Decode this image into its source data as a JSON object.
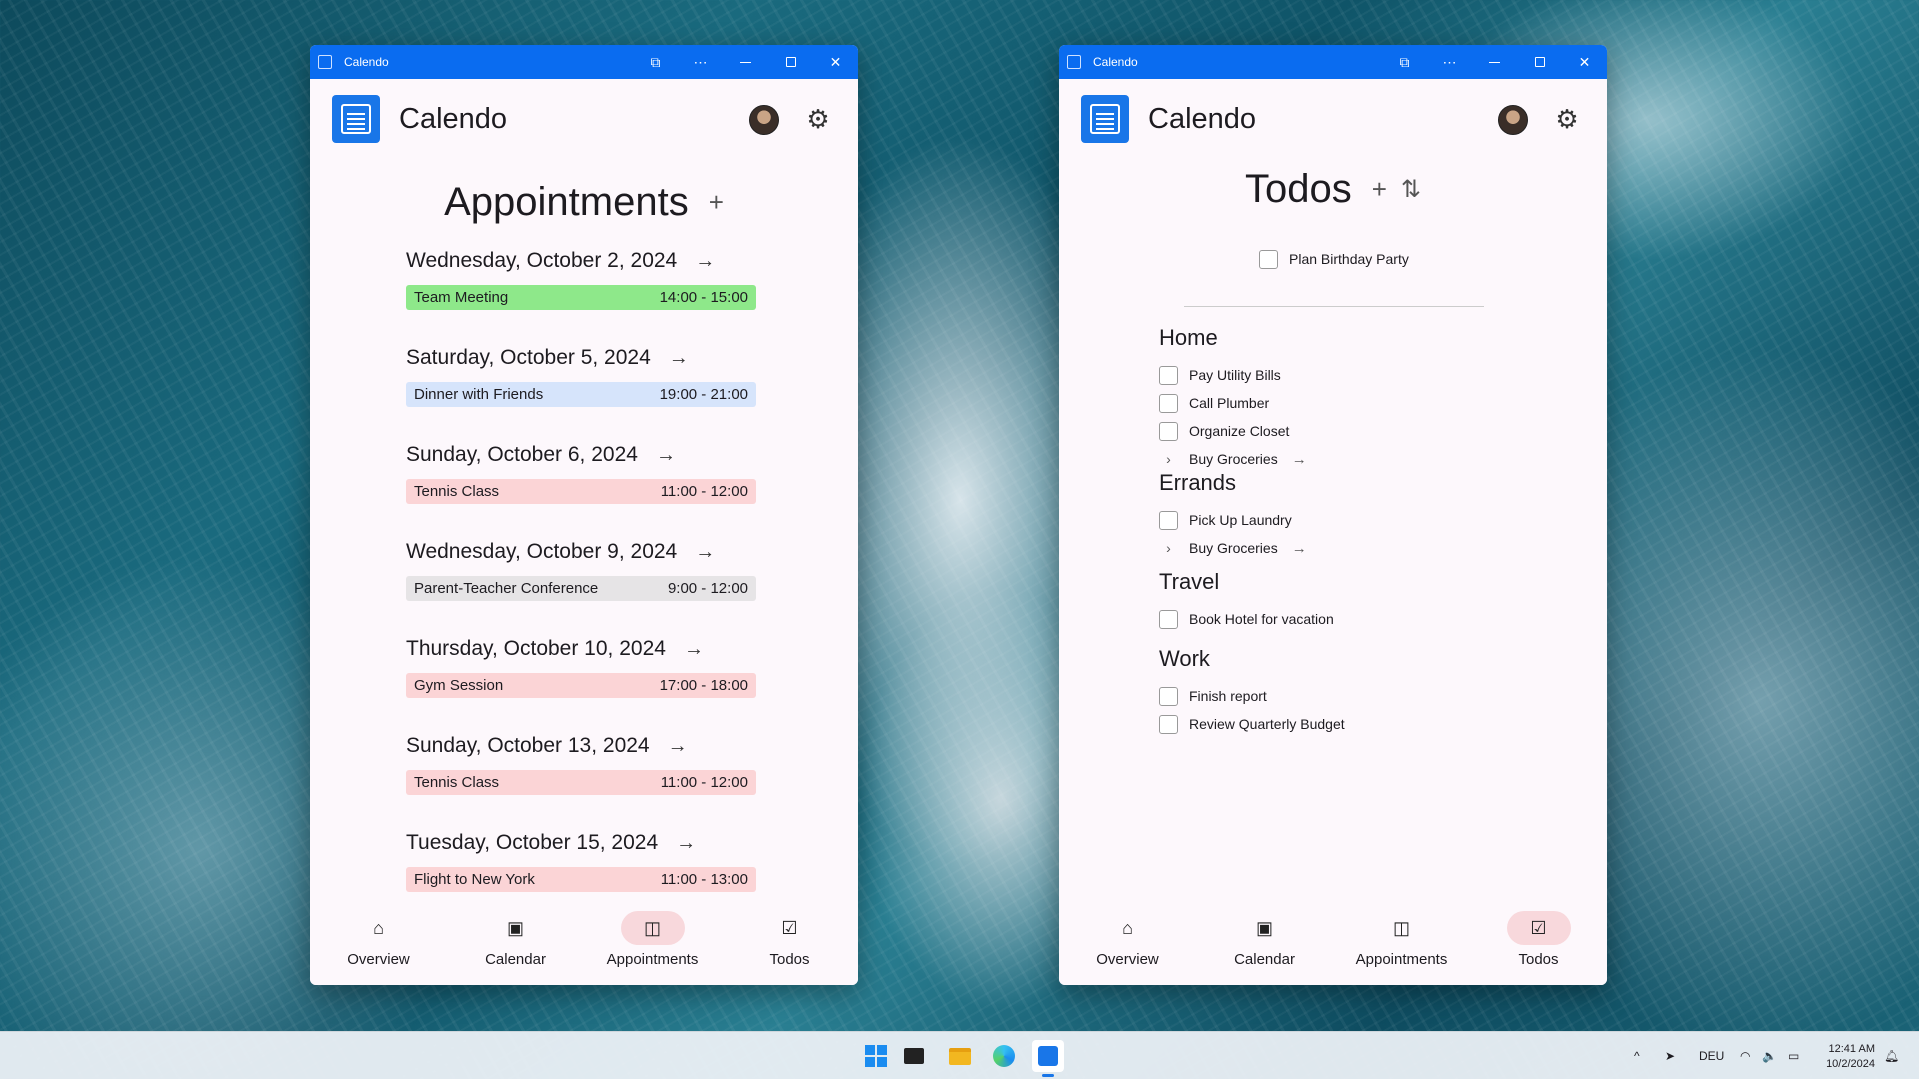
{
  "windows": {
    "left": {
      "title": "Calendo",
      "app_name": "Calendo",
      "page_title": "Appointments",
      "days": [
        {
          "date": "Wednesday, October 2, 2024",
          "event": "Team Meeting",
          "time": "14:00 - 15:00",
          "color": "#8ee88a"
        },
        {
          "date": "Saturday, October 5, 2024",
          "event": "Dinner with Friends",
          "time": "19:00 - 21:00",
          "color": "#d6e4fb"
        },
        {
          "date": "Sunday, October 6, 2024",
          "event": "Tennis Class",
          "time": "11:00 - 12:00",
          "color": "#fbd4d6"
        },
        {
          "date": "Wednesday, October 9, 2024",
          "event": "Parent-Teacher Conference",
          "time": "9:00 - 12:00",
          "color": "#e6e4e6"
        },
        {
          "date": "Thursday, October 10, 2024",
          "event": "Gym Session",
          "time": "17:00 - 18:00",
          "color": "#fbd4d6"
        },
        {
          "date": "Sunday, October 13, 2024",
          "event": "Tennis Class",
          "time": "11:00 - 12:00",
          "color": "#fbd4d6"
        },
        {
          "date": "Tuesday, October 15, 2024",
          "event": "Flight to New York",
          "time": "11:00 - 13:00",
          "color": "#fbd4d6"
        }
      ],
      "nav": [
        "Overview",
        "Calendar",
        "Appointments",
        "Todos"
      ],
      "active_nav": "Appointments"
    },
    "right": {
      "title": "Calendo",
      "app_name": "Calendo",
      "page_title": "Todos",
      "single_todo": "Plan Birthday Party",
      "categories": [
        {
          "name": "Home",
          "items": [
            {
              "label": "Pay Utility Bills",
              "type": "checkbox"
            },
            {
              "label": "Call Plumber",
              "type": "checkbox"
            },
            {
              "label": "Organize Closet",
              "type": "checkbox"
            },
            {
              "label": "Buy Groceries",
              "type": "link"
            }
          ]
        },
        {
          "name": "Errands",
          "items": [
            {
              "label": "Pick Up Laundry",
              "type": "checkbox"
            },
            {
              "label": "Buy Groceries",
              "type": "link"
            }
          ]
        },
        {
          "name": "Travel",
          "items": [
            {
              "label": "Book Hotel for vacation",
              "type": "checkbox"
            }
          ]
        },
        {
          "name": "Work",
          "items": [
            {
              "label": "Finish report",
              "type": "checkbox"
            },
            {
              "label": "Review Quarterly Budget",
              "type": "checkbox"
            }
          ]
        }
      ],
      "nav": [
        "Overview",
        "Calendar",
        "Appointments",
        "Todos"
      ],
      "active_nav": "Todos"
    }
  },
  "taskbar": {
    "language": "DEU",
    "time": "12:41 AM",
    "date": "10/2/2024"
  },
  "colors": {
    "titlebar": "#0a6cf0",
    "active_nav_pill": "#f8d8dc"
  }
}
